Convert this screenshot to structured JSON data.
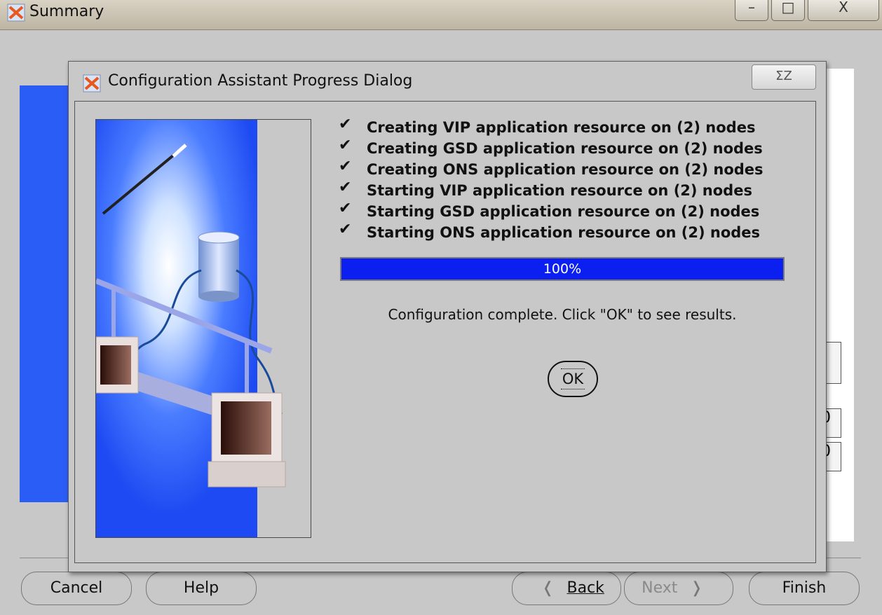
{
  "window": {
    "title": "Summary",
    "controls": {
      "minimize": "–",
      "maximize": "□",
      "close": "X"
    }
  },
  "background_fields": [
    "",
    "0",
    "0"
  ],
  "buttons": {
    "cancel": "Cancel",
    "help": "Help",
    "back": "Back",
    "next": "Next",
    "finish": "Finish"
  },
  "dialog": {
    "title": "Configuration Assistant Progress Dialog",
    "close_label": "ΣΖ",
    "tasks": [
      {
        "check": "✔",
        "text": "Creating VIP application resource on (2) nodes"
      },
      {
        "check": "✔",
        "text": "Creating GSD application resource on (2) nodes"
      },
      {
        "check": "✔",
        "text": "Creating ONS application resource on (2) nodes"
      },
      {
        "check": "✔",
        "text": "Starting VIP application resource on (2) nodes"
      },
      {
        "check": "✔",
        "text": "Starting GSD application resource on (2) nodes"
      },
      {
        "check": "✔",
        "text": "Starting ONS application resource on (2) nodes"
      }
    ],
    "progress": {
      "value": 100,
      "label": "100%"
    },
    "message": "Configuration complete. Click \"OK\" to see results.",
    "ok_label": "OK"
  },
  "colors": {
    "progress_fill": "#0a1ff0",
    "illustration_blue": "#2a5df5",
    "dialog_bg": "#c8c8c8"
  }
}
